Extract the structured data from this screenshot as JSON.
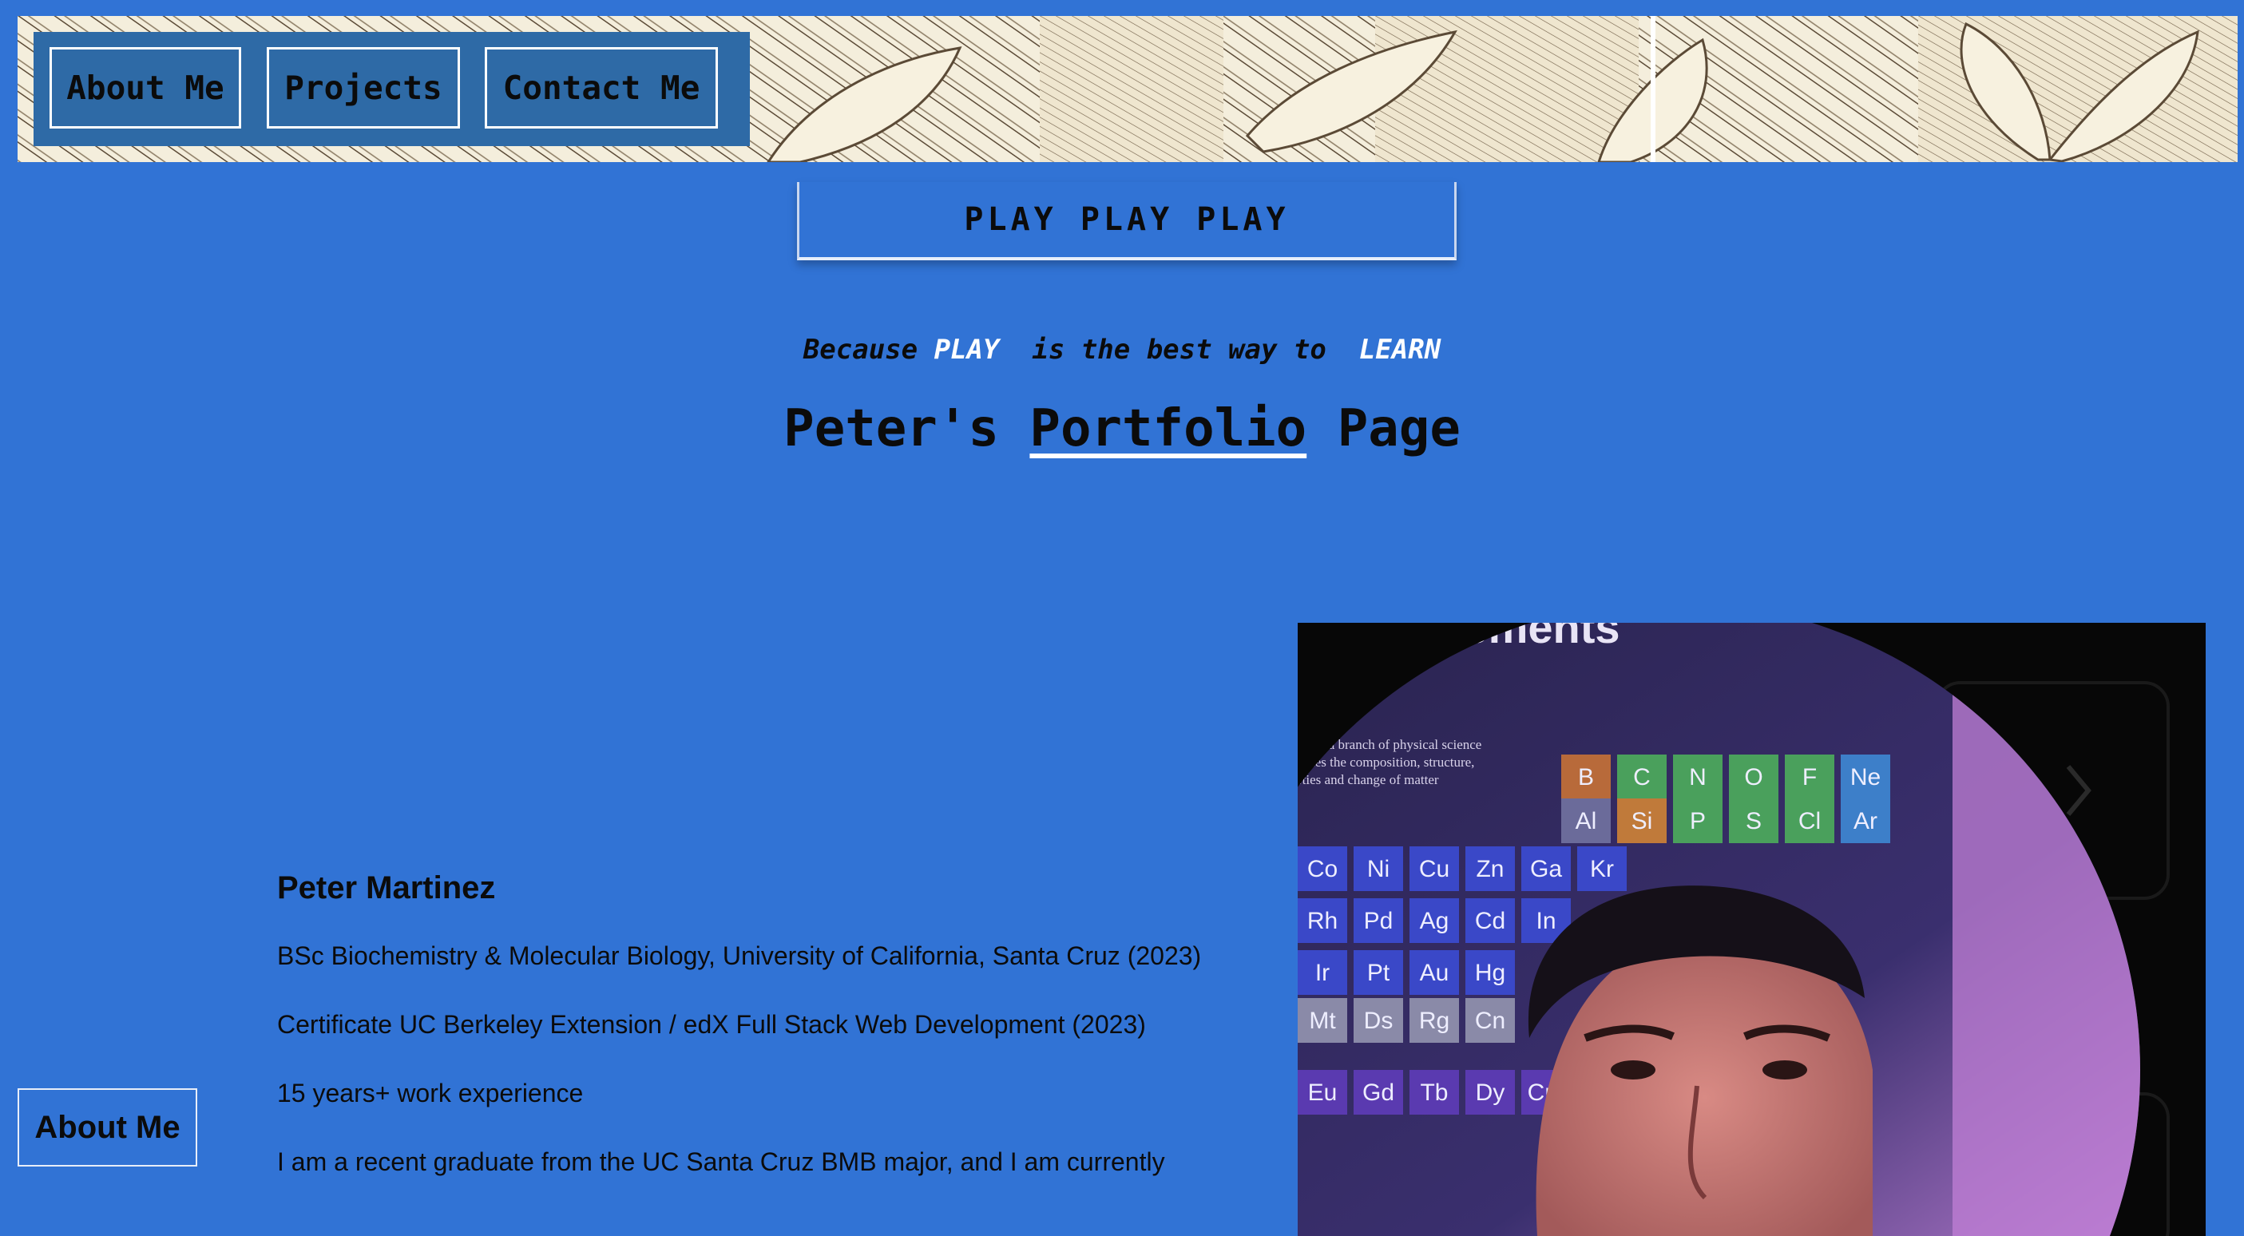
{
  "nav": {
    "items": [
      {
        "label": "About Me"
      },
      {
        "label": "Projects"
      },
      {
        "label": "Contact Me"
      }
    ]
  },
  "hero": {
    "banner_text": "PLAY PLAY PLAY",
    "tagline": {
      "prefix": "Because ",
      "word1": "PLAY",
      "middle": "  is the best way to  ",
      "word2": "LEARN"
    },
    "title": {
      "before": "Peter's ",
      "underlined": "Portfolio",
      "after": " Page"
    }
  },
  "about": {
    "tab_label": "About Me",
    "name": "Peter Martinez",
    "paragraphs": [
      "BSc Biochemistry & Molecular Biology, University of California, Santa Cruz (2023)",
      "Certificate UC Berkeley Extension / edX Full Stack Web Development (2023)",
      "15 years+ work experience",
      "I am a recent graduate from the UC Santa Cruz BMB major, and I am currently"
    ]
  },
  "photo": {
    "poster_title": "the Elements",
    "poster_text": [
      "try is a branch of physical science",
      "udies the composition, structure,",
      "rties and change of matter"
    ],
    "elements": [
      "B",
      "C",
      "N",
      "O",
      "F",
      "Ne",
      "Al",
      "Si",
      "P",
      "S",
      "Cl",
      "Ar",
      "Co",
      "Ni",
      "Cu",
      "Zn",
      "Ga",
      "Kr",
      "Rh",
      "Pd",
      "Ag",
      "Cd",
      "In",
      "Ir",
      "Pt",
      "Au",
      "Hg",
      "Mt",
      "Ds",
      "Rg",
      "Cn",
      "Eu",
      "Gd",
      "Tb",
      "Dy",
      "Cm"
    ]
  },
  "colors": {
    "page_background": "#3173d5",
    "nav_background": "#2e6aa6",
    "highlight": "#ffffff"
  }
}
